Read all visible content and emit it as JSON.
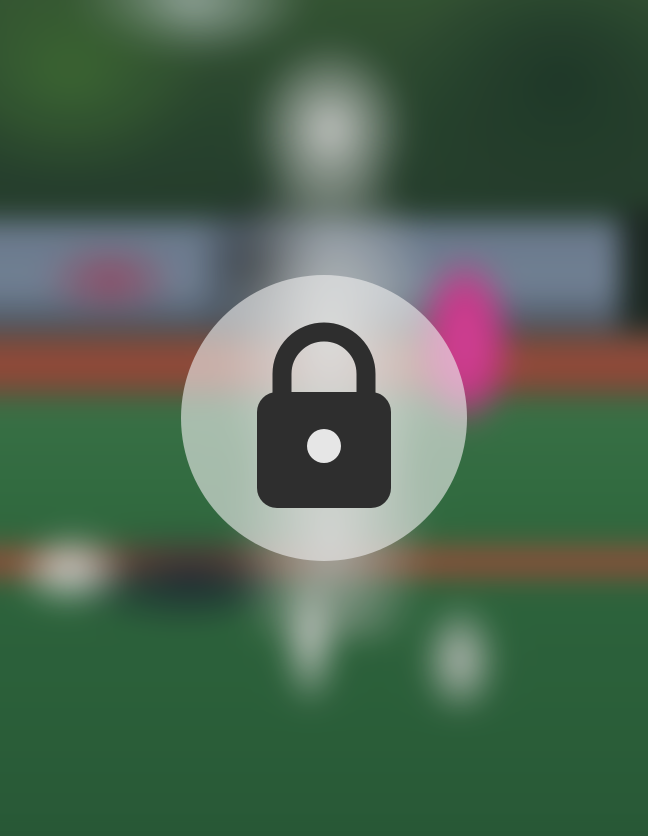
{
  "screen": {
    "state": "locked",
    "icon": "lock-icon"
  },
  "colors": {
    "badge": "#eeeeee",
    "icon": "#2e2e2e",
    "frisbee": "#d73b93",
    "grass": "#2f6b3f",
    "track": "#a44d3b"
  }
}
